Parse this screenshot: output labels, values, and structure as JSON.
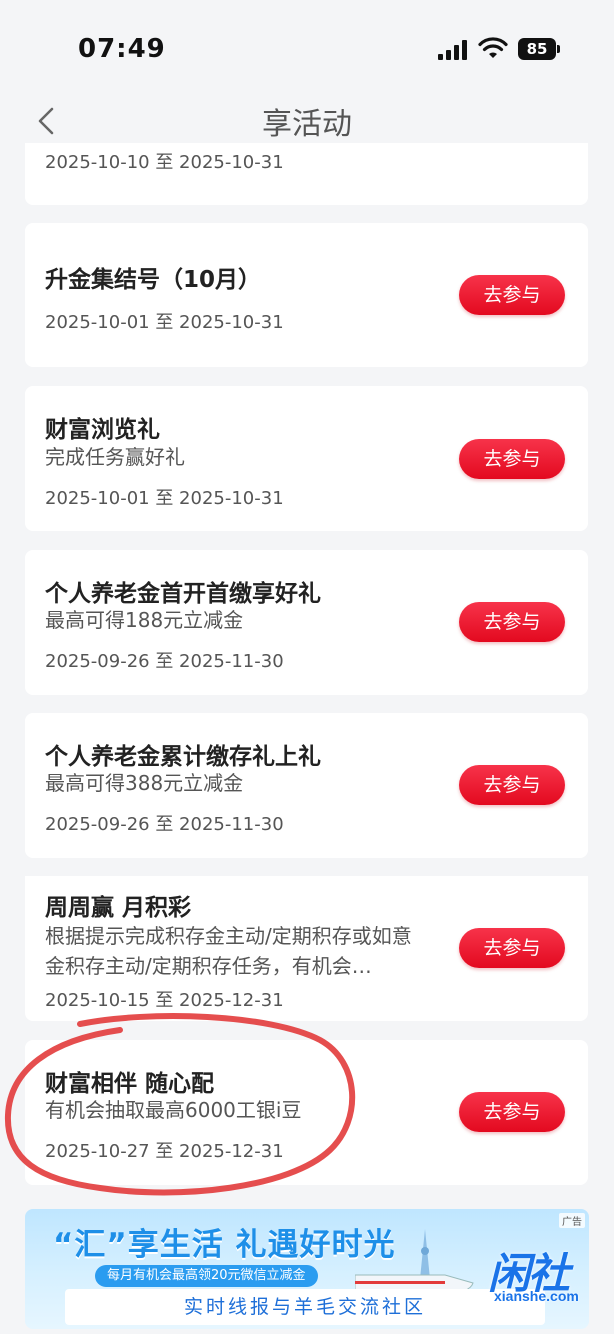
{
  "status_bar": {
    "time": "07:49",
    "battery": "85"
  },
  "nav": {
    "title": "享活动"
  },
  "join_label": "去参与",
  "cards": [
    {
      "title": "",
      "desc": "",
      "date": "2025-10-10 至 2025-10-31"
    },
    {
      "title": "升金集结号（10月）",
      "desc": "",
      "date": "2025-10-01 至 2025-10-31"
    },
    {
      "title": "财富浏览礼",
      "desc": "完成任务赢好礼",
      "date": "2025-10-01 至 2025-10-31"
    },
    {
      "title": "个人养老金首开首缴享好礼",
      "desc": "最高可得188元立减金",
      "date": "2025-09-26 至 2025-11-30"
    },
    {
      "title": "个人养老金累计缴存礼上礼",
      "desc": "最高可得388元立减金",
      "date": "2025-09-26 至 2025-11-30"
    },
    {
      "title": "周周赢 月积彩",
      "desc": "根据提示完成积存金主动/定期积存或如意金积存主动/定期积存任务，有机会…",
      "date": "2025-10-15 至 2025-12-31"
    },
    {
      "title": "财富相伴 随心配",
      "desc": "有机会抽取最高6000工银i豆",
      "date": "2025-10-27 至 2025-12-31"
    }
  ],
  "banner": {
    "title": "“汇”享生活  礼遇好时光",
    "pill": "每月有机会最高领20元微信立减金",
    "ad_tag": "广告",
    "bottom_text": "实时线报与羊毛交流社区"
  },
  "watermark": {
    "main": "闲社",
    "sub": "xianshe.com"
  },
  "colors": {
    "accent_red": "#e3091f",
    "banner_blue": "#1e8fe8"
  }
}
